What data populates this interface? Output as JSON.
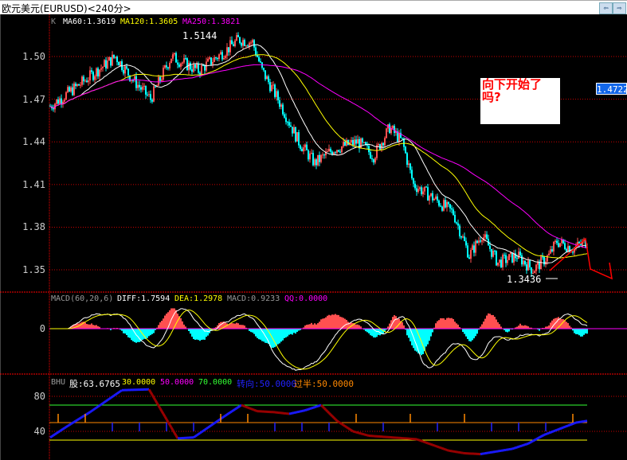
{
  "window": {
    "title": "欧元美元(EURUSD)<240分>",
    "nav_prev": "⇦",
    "nav_next": "⇨"
  },
  "main": {
    "legend": {
      "k": "K",
      "ma60": "MA60:1.3619",
      "ma120": "MA120:1.3605",
      "ma250": "MA250:1.3821"
    },
    "yticks": [
      "1.50",
      "1.47",
      "1.44",
      "1.41",
      "1.38",
      "1.35"
    ],
    "high_label": "1.5144",
    "low_label": "1.3436",
    "price_tag": "1.4722",
    "annotation": "向下开始了吗?"
  },
  "macd": {
    "title": "MACD(60,20,6)",
    "diff": "DIFF:1.7594",
    "dea": "DEA:1.2978",
    "macd": "MACD:0.9233",
    "qq": "QQ:0.0000",
    "ytick": "0"
  },
  "bhu": {
    "title": "BHU",
    "gu": "股:63.6765",
    "l30": "30.0000",
    "l50": "50.0000",
    "l70": "70.0000",
    "turn": "转向:50.0000",
    "half": "过半:50.0000",
    "yticks": [
      "80",
      "40"
    ]
  },
  "colors": {
    "up": "#ff5050",
    "down": "#00ffff",
    "ma60": "#ffffff",
    "ma120": "#ffff00",
    "ma250": "#ff00ff",
    "grid": "#ff0000"
  },
  "chart_data": {
    "type": "candlestick",
    "ylim": [
      1.335,
      1.53
    ],
    "price_path": [
      [
        0,
        1.465
      ],
      [
        18,
        1.48
      ],
      [
        41,
        1.5
      ],
      [
        51,
        1.485
      ],
      [
        63,
        1.47
      ],
      [
        76,
        1.5
      ],
      [
        93,
        1.49
      ],
      [
        111,
        1.505
      ],
      [
        118,
        1.512
      ],
      [
        127,
        1.51
      ],
      [
        133,
        1.49
      ],
      [
        143,
        1.47
      ],
      [
        156,
        1.44
      ],
      [
        166,
        1.425
      ],
      [
        178,
        1.435
      ],
      [
        193,
        1.44
      ],
      [
        203,
        1.43
      ],
      [
        213,
        1.45
      ],
      [
        221,
        1.44
      ],
      [
        228,
        1.41
      ],
      [
        241,
        1.4
      ],
      [
        253,
        1.39
      ],
      [
        263,
        1.36
      ],
      [
        271,
        1.375
      ],
      [
        281,
        1.355
      ],
      [
        293,
        1.36
      ],
      [
        303,
        1.35
      ],
      [
        313,
        1.36
      ],
      [
        318,
        1.37
      ],
      [
        328,
        1.365
      ],
      [
        337,
        1.37
      ]
    ],
    "bhu_path": [
      [
        0,
        33
      ],
      [
        10,
        45
      ],
      [
        25,
        62
      ],
      [
        45,
        87
      ],
      [
        62,
        88
      ],
      [
        80,
        32
      ],
      [
        90,
        33
      ],
      [
        110,
        58
      ],
      [
        120,
        70
      ],
      [
        130,
        63
      ],
      [
        140,
        62
      ],
      [
        150,
        60
      ],
      [
        160,
        64
      ],
      [
        170,
        70
      ],
      [
        180,
        52
      ],
      [
        190,
        40
      ],
      [
        200,
        35
      ],
      [
        230,
        31
      ],
      [
        250,
        18
      ],
      [
        260,
        15
      ],
      [
        270,
        14
      ],
      [
        290,
        20
      ],
      [
        300,
        26
      ],
      [
        310,
        36
      ],
      [
        320,
        43
      ],
      [
        330,
        50
      ],
      [
        337,
        52
      ]
    ]
  }
}
